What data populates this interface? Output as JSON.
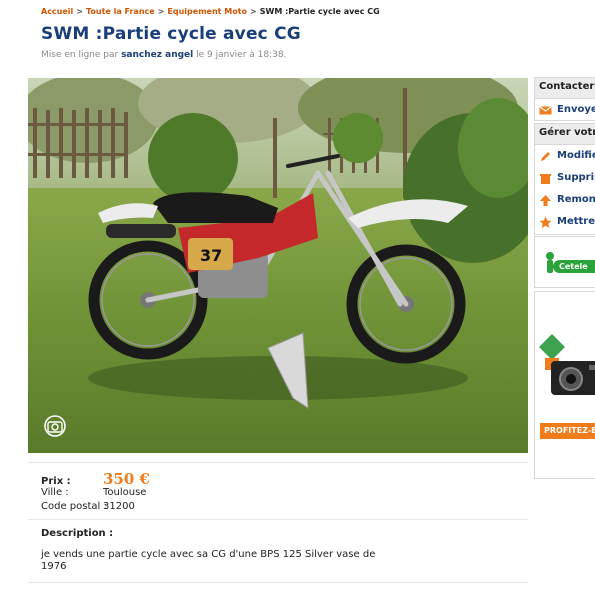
{
  "breadcrumb": {
    "items": [
      "Accueil",
      "Toute la France",
      "Equipement Moto"
    ],
    "current": "SWM :Partie cycle avec CG",
    "separator": ">"
  },
  "listing": {
    "title": "SWM :Partie cycle avec CG",
    "posted_prefix": "Mise en ligne par",
    "author": "sanchez angel",
    "posted_suffix": "le 9 janvier à 18:38."
  },
  "details": {
    "price_label": "Prix :",
    "price_value": "350 €",
    "city_label": "Ville :",
    "city_value": "Toulouse",
    "postal_label": "Code postal :",
    "postal_value": "31200"
  },
  "description": {
    "label": "Description :",
    "text": "je vends une partie cycle avec sa CG d'une BPS 125 Silver vase de 1976"
  },
  "photo": {
    "race_number": "37"
  },
  "sidebar": {
    "contact_header": "Contacter l",
    "contact_link": "Envoye",
    "manage_header": "Gérer votr",
    "manage_links": [
      {
        "label": "Modifie",
        "icon": "pencil-icon"
      },
      {
        "label": "Supprir",
        "icon": "delete-icon"
      },
      {
        "label": "Remont",
        "icon": "arrow-up-icon"
      },
      {
        "label": "Mettre",
        "icon": "star-icon"
      }
    ],
    "ad1_text": "Cetele",
    "ad2_cta": "PROFITEZ-EN"
  },
  "colors": {
    "title": "#1a3e7a",
    "price": "#f07c1c",
    "link_accent": "#d35400"
  }
}
